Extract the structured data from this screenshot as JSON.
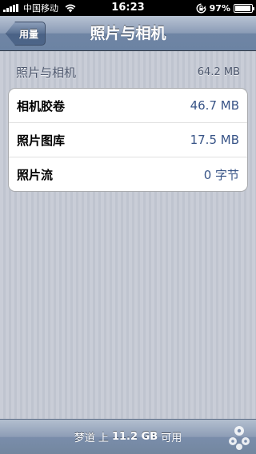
{
  "status_bar": {
    "carrier": "中国移动",
    "time": "16:23",
    "battery": "97%",
    "battery_level": 0.97,
    "icons": [
      "signal-icon",
      "wifi-icon",
      "rotation-lock-icon",
      "battery-icon"
    ]
  },
  "nav": {
    "back_label": "用量",
    "title": "照片与相机"
  },
  "section": {
    "title": "照片与相机",
    "size": "64.2 MB"
  },
  "rows": [
    {
      "label": "相机胶卷",
      "value": "46.7 MB"
    },
    {
      "label": "照片图库",
      "value": "17.5 MB"
    },
    {
      "label": "照片流",
      "value": "0 字节"
    }
  ],
  "bottom": {
    "prefix": "梦道 上 ",
    "amount": "11.2 GB",
    "suffix": " 可用"
  },
  "colors": {
    "nav_gradient_top": "#b8c3d3",
    "nav_gradient_bottom": "#6c83a3",
    "value_text": "#385487",
    "section_text": "#4c566c"
  }
}
